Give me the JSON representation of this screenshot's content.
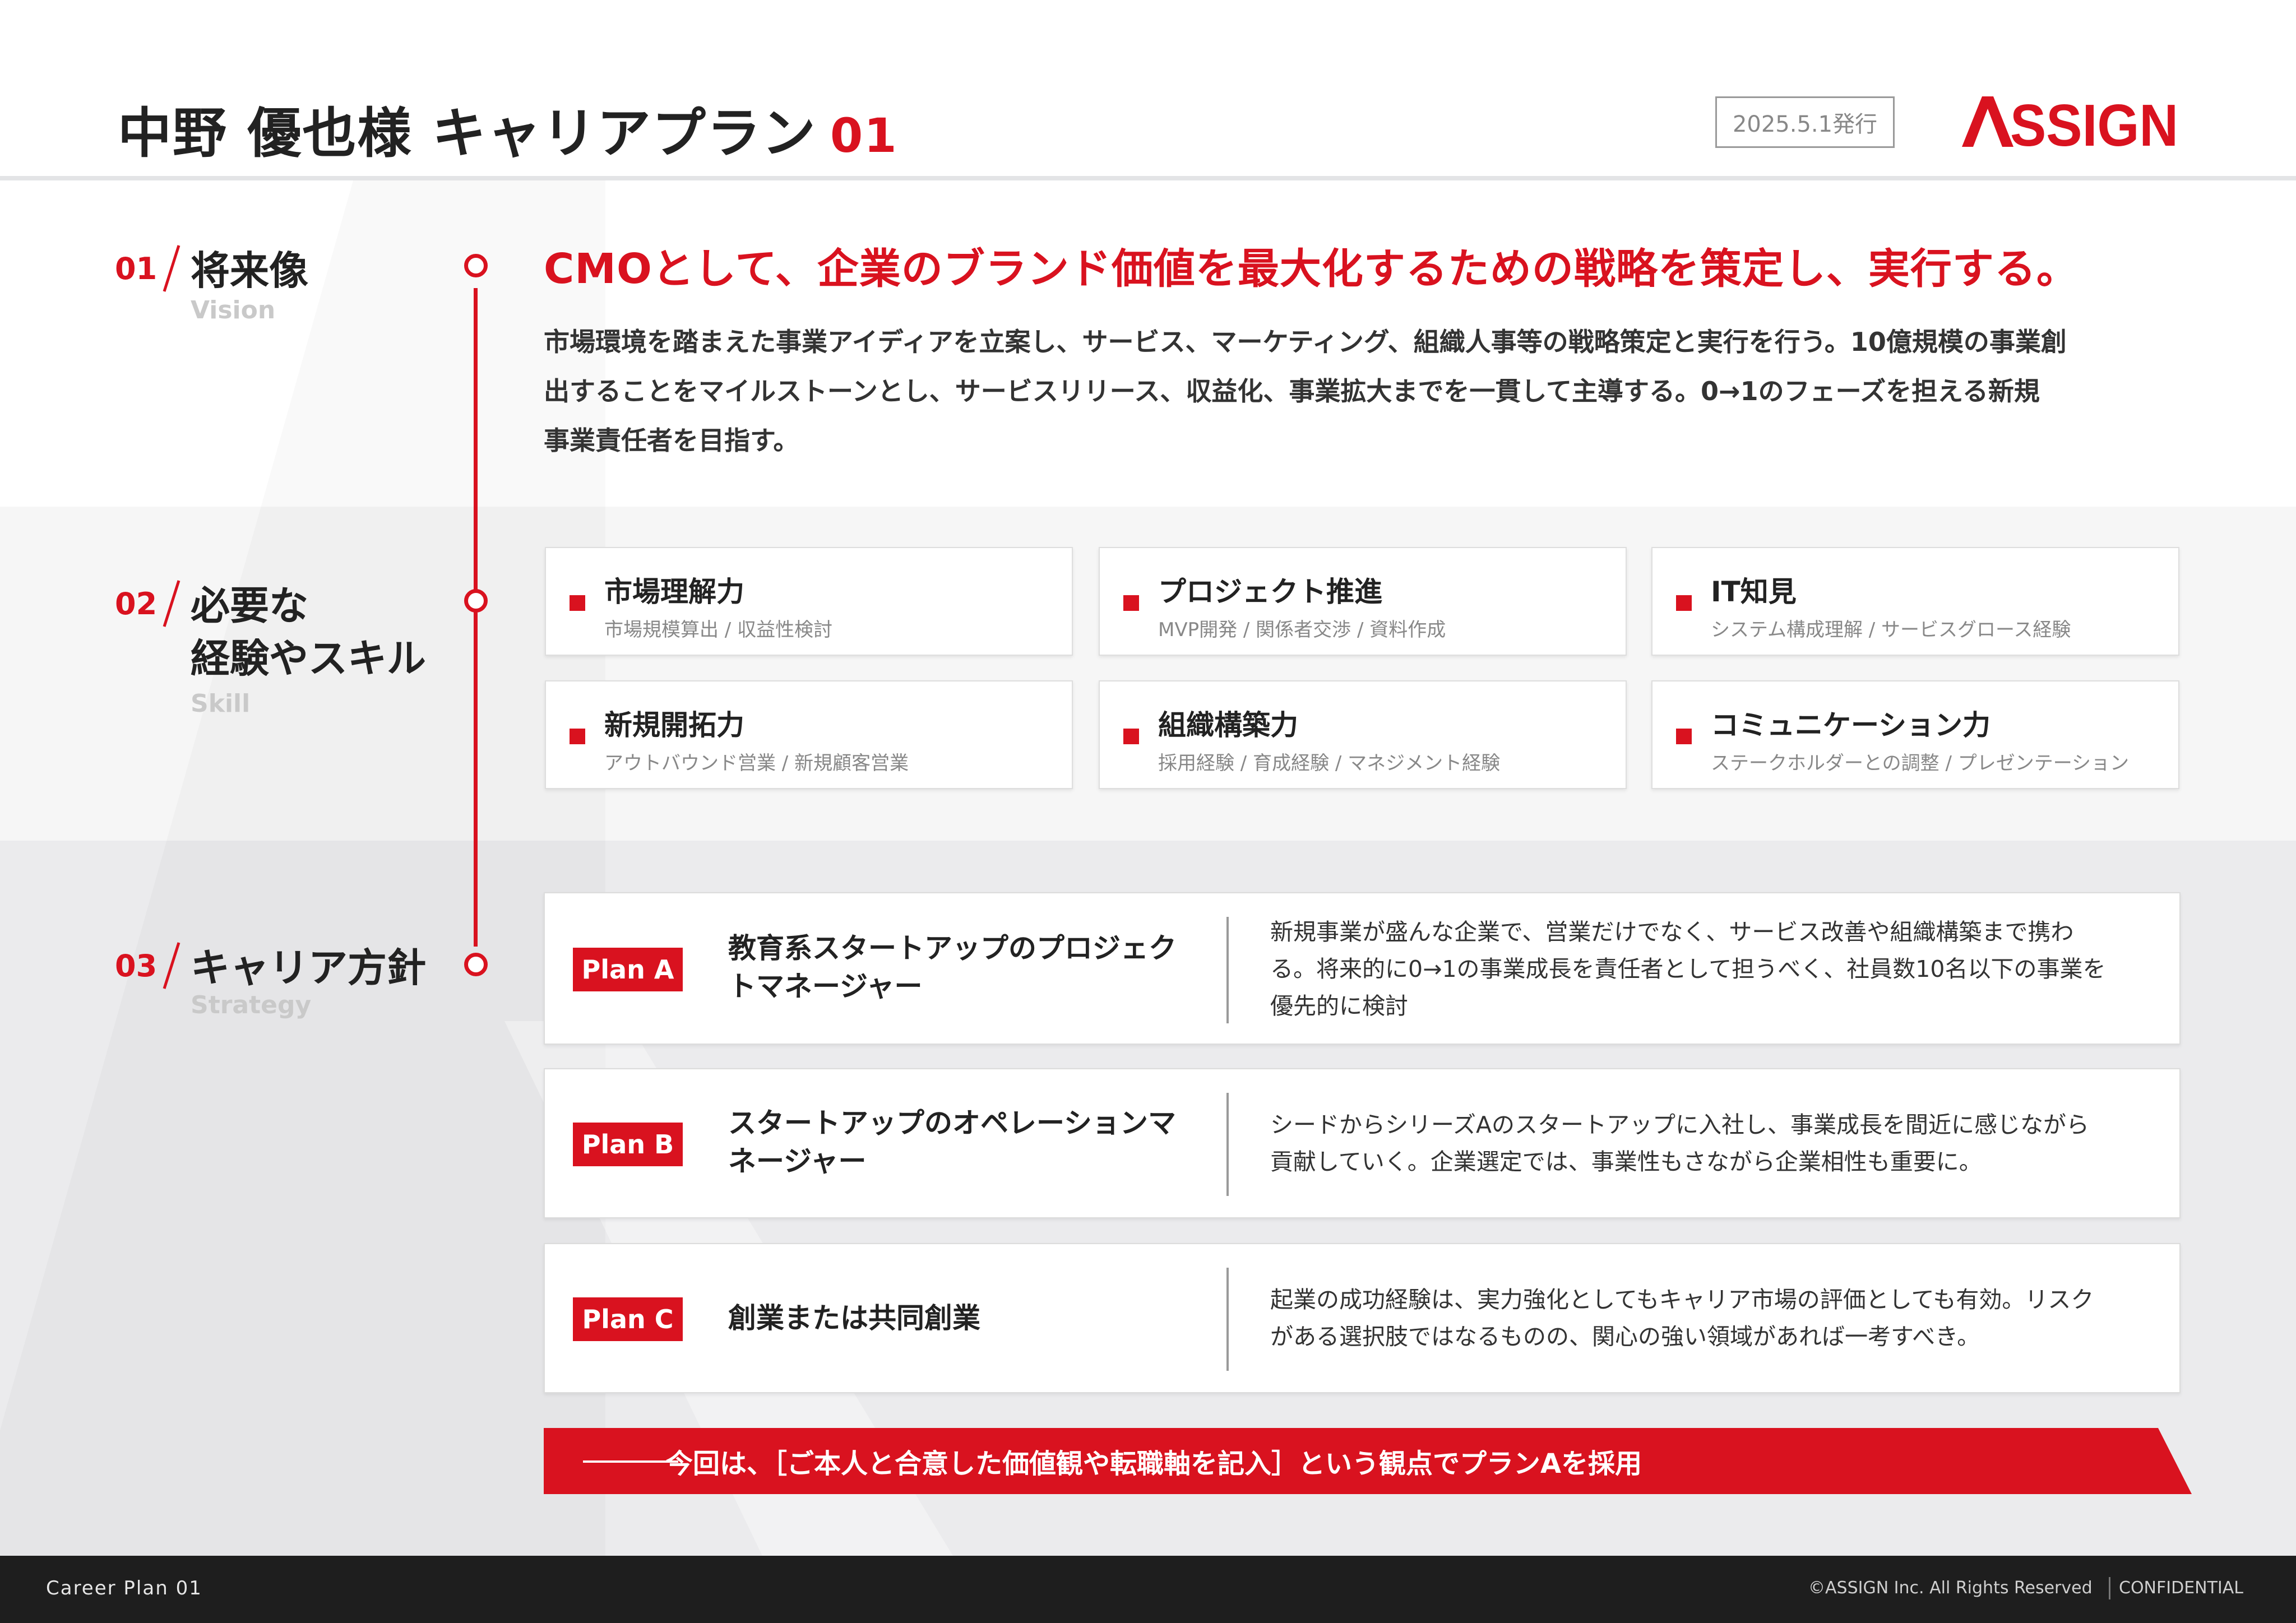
{
  "header": {
    "title": "中野 優也様 キャリアプラン",
    "title_number": "01",
    "issue_date": "2025.5.1発行",
    "logo_text": "ASSIGN"
  },
  "sections": {
    "vision": {
      "number": "01",
      "title": "将来像",
      "subtitle": "Vision"
    },
    "skill": {
      "number": "02",
      "title_line1": "必要な",
      "title_line2": "経験やスキル",
      "subtitle": "Skill"
    },
    "strategy": {
      "number": "03",
      "title": "キャリア方針",
      "subtitle": "Strategy"
    }
  },
  "vision": {
    "headline": "CMOとして、企業のブランド価値を最大化するための戦略を策定し、実行する。",
    "body_lines": [
      "市場環境を踏まえた事業アイディアを立案し、サービス、マーケティング、組織人事等の戦略策定と実行を行う。10億規模の事業創",
      "出することをマイルストーンとし、サービスリリース、収益化、事業拡大までを一貫して主導する。0→1のフェーズを担える新規",
      "事業責任者を目指す。"
    ]
  },
  "skills": [
    {
      "name": "市場理解力",
      "desc": "市場規模算出 / 収益性検討"
    },
    {
      "name": "プロジェクト推進",
      "desc": "MVP開発 / 関係者交渉 / 資料作成"
    },
    {
      "name": "IT知見",
      "desc": "システム構成理解 / サービスグロース経験"
    },
    {
      "name": "新規開拓力",
      "desc": "アウトバウンド営業 / 新規顧客営業"
    },
    {
      "name": "組織構築力",
      "desc": "採用経験 / 育成経験 / マネジメント経験"
    },
    {
      "name": "コミュニケーション力",
      "desc": "ステークホルダーとの調整 / プレゼンテーション"
    }
  ],
  "plans": [
    {
      "badge": "Plan A",
      "title_lines": [
        "教育系スタートアップのプロジェク",
        "トマネージャー"
      ],
      "desc_lines": [
        "新規事業が盛んな企業で、営業だけでなく、サービス改善や組織構築まで携わ",
        "る。将来的に0→1の事業成長を責任者として担うべく、社員数10名以下の事業を",
        "優先的に検討"
      ]
    },
    {
      "badge": "Plan B",
      "title_lines": [
        "スタートアップのオペレーションマ",
        "ネージャー"
      ],
      "desc_lines": [
        "シードからシリーズAのスタートアップに入社し、事業成長を間近に感じながら",
        "貢献していく。企業選定では、事業性もさながら企業相性も重要に。"
      ]
    },
    {
      "badge": "Plan C",
      "title_lines": [
        "創業または共同創業"
      ],
      "desc_lines": [
        "起業の成功経験は、実力強化としてもキャリア市場の評価としても有効。リスク",
        "がある選択肢ではなるものの、関心の強い領域があれば一考すべき。"
      ]
    }
  ],
  "conclusion": "今回は、［ご本人と合意した価値観や転職軸を記入］という観点でプランAを採用",
  "footer": {
    "left": "Career Plan 01",
    "copyright": "©ASSIGN Inc. All Rights Reserved",
    "confidential": "CONFIDENTIAL"
  },
  "colors": {
    "accent": "#d9121f",
    "footer_bg": "#1e1e1e",
    "band_skill": "#f6f6f6",
    "band_strategy": "#ebebed"
  }
}
